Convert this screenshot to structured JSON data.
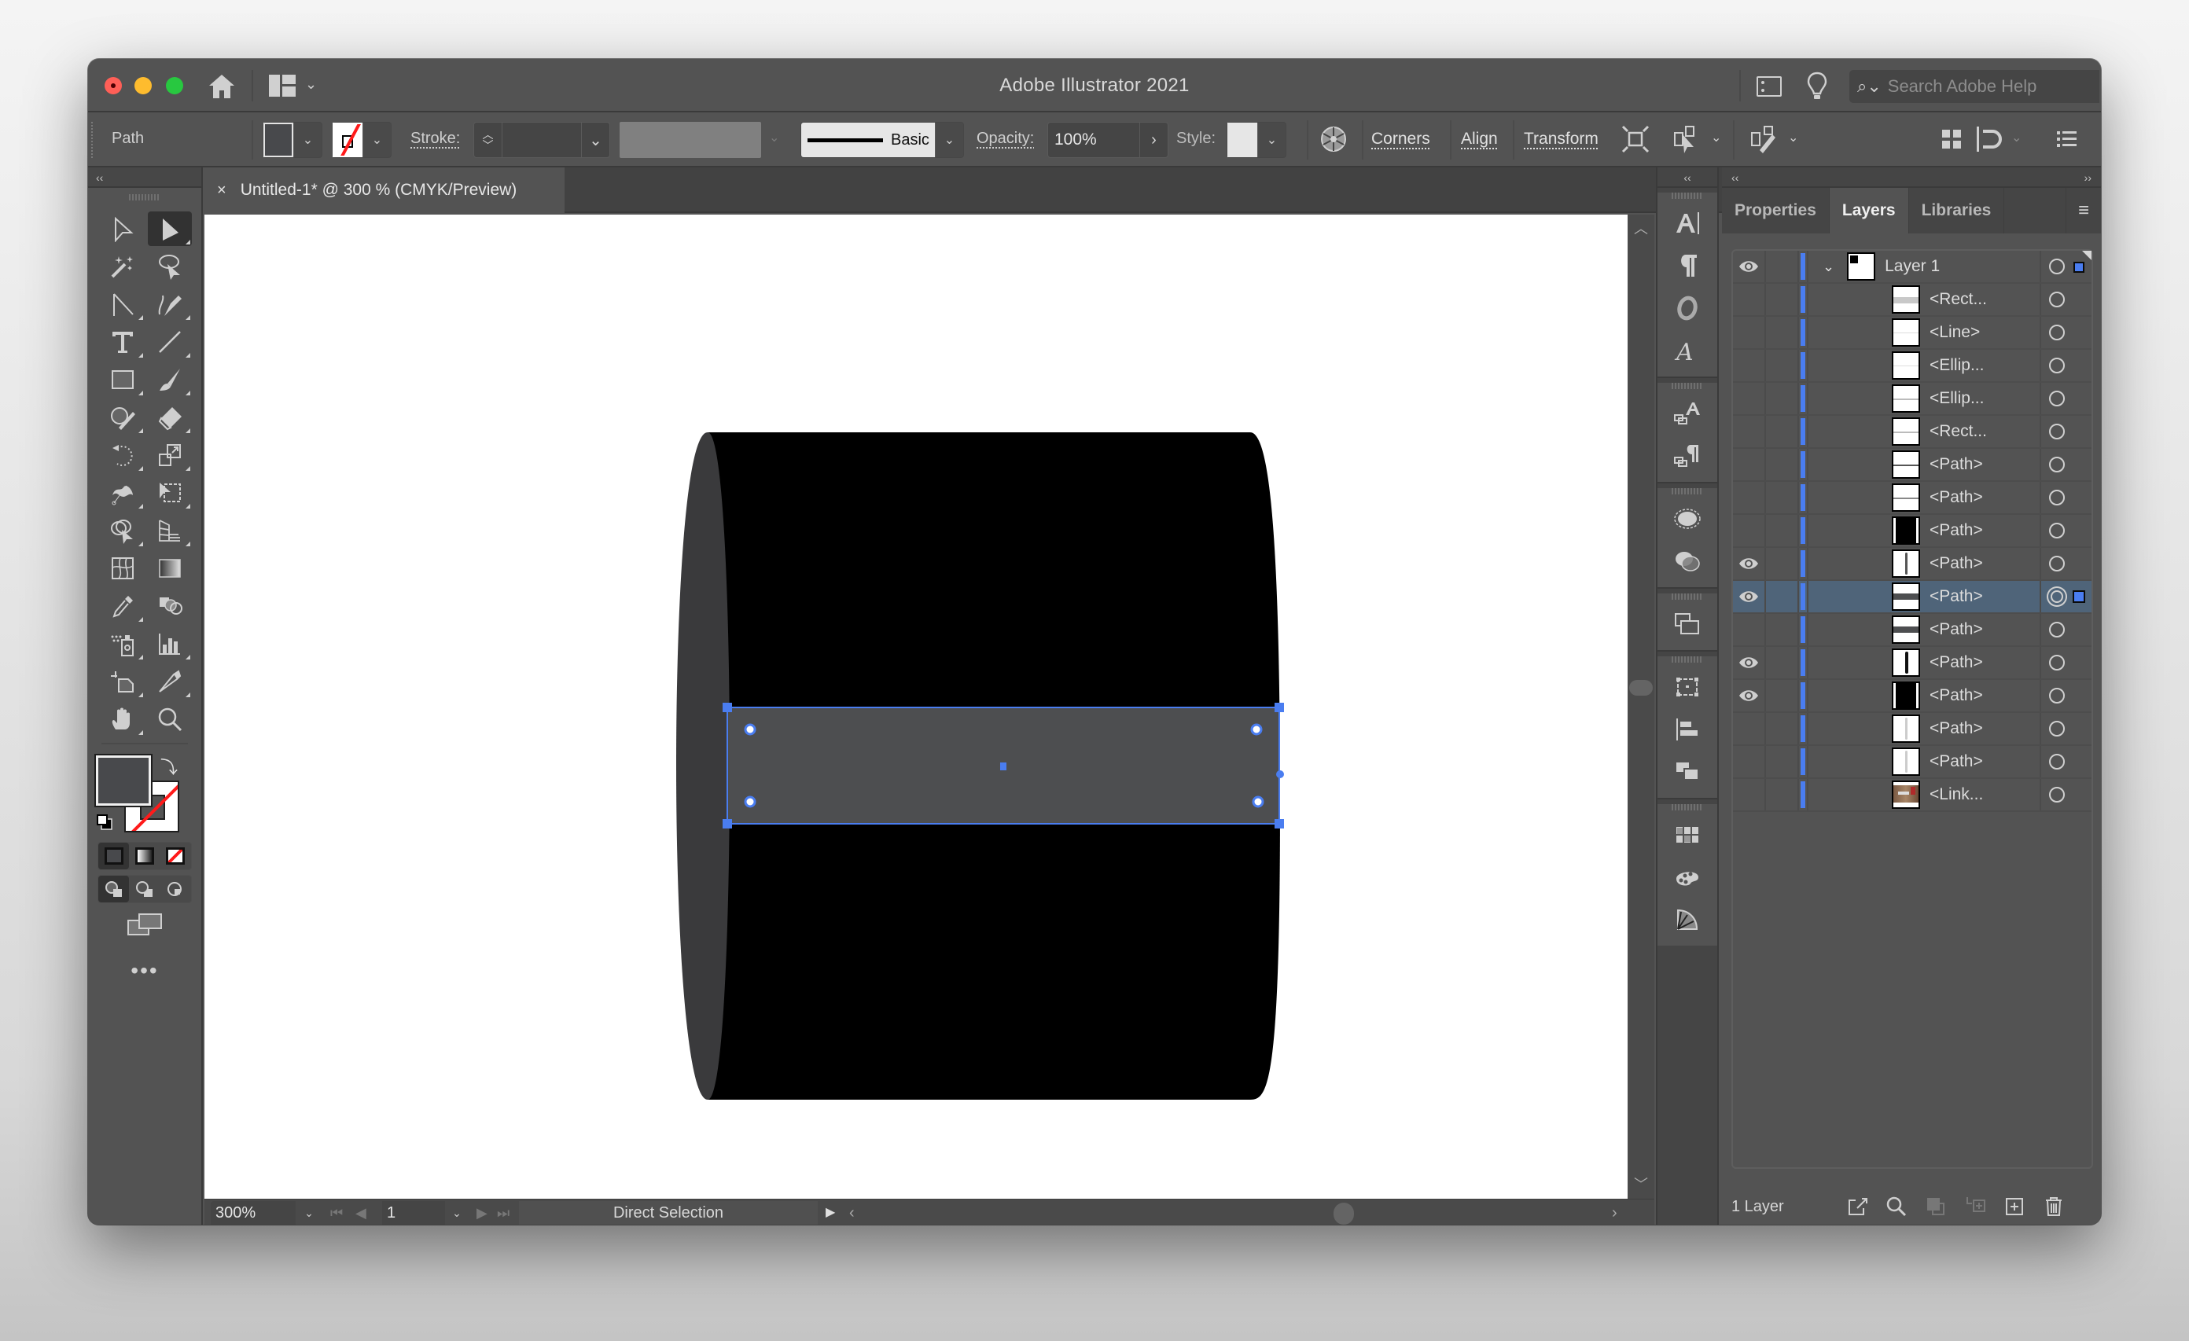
{
  "window": {
    "title": "Adobe Illustrator 2021",
    "help_search_placeholder": "Search Adobe Help"
  },
  "control_bar": {
    "selection_type": "Path",
    "fill_color": "#48494c",
    "stroke_color": "none",
    "stroke_label": "Stroke:",
    "stroke_weight": "",
    "brush_definition": "Basic",
    "opacity_label": "Opacity:",
    "opacity_value": "100%",
    "style_label": "Style:",
    "links": [
      "Corners",
      "Align",
      "Transform"
    ]
  },
  "document_tab": {
    "close": "×",
    "title": "Untitled-1* @ 300 % (CMYK/Preview)"
  },
  "toolbar": {
    "active_tool": "Direct Selection",
    "fill_color": "#48494c",
    "stroke_color": "none",
    "more_label": "•••"
  },
  "status_bar": {
    "zoom": "300%",
    "artboard": "1",
    "current_tool": "Direct Selection"
  },
  "artwork": {
    "body_color": "#000000",
    "end_cap_color": "#3a3a3c",
    "selected_rect_color": "#4d4e50",
    "selection_color": "#4a7df0"
  },
  "panel": {
    "tabs": [
      "Properties",
      "Layers",
      "Libraries"
    ],
    "active_tab": "Layers",
    "layer": {
      "name": "Layer 1",
      "visible": true,
      "expanded": true,
      "color": "#4a7df0"
    },
    "items": [
      {
        "name": "<Rect...",
        "visible": false,
        "selected": false,
        "thumb": "hband-light"
      },
      {
        "name": "<Line>",
        "visible": false,
        "selected": false,
        "thumb": "hline-faint"
      },
      {
        "name": "<Ellip...",
        "visible": false,
        "selected": false,
        "thumb": "hline-faint"
      },
      {
        "name": "<Ellip...",
        "visible": false,
        "selected": false,
        "thumb": "hline-gray"
      },
      {
        "name": "<Rect...",
        "visible": false,
        "selected": false,
        "thumb": "hline-gray"
      },
      {
        "name": "<Path>",
        "visible": false,
        "selected": false,
        "thumb": "hline-dark"
      },
      {
        "name": "<Path>",
        "visible": false,
        "selected": false,
        "thumb": "hline-mid"
      },
      {
        "name": "<Path>",
        "visible": false,
        "selected": false,
        "thumb": "black-block"
      },
      {
        "name": "<Path>",
        "visible": true,
        "selected": false,
        "thumb": "vline-dark"
      },
      {
        "name": "<Path>",
        "visible": true,
        "selected": true,
        "thumb": "hband-dark"
      },
      {
        "name": "<Path>",
        "visible": false,
        "selected": false,
        "thumb": "hband-dark"
      },
      {
        "name": "<Path>",
        "visible": true,
        "selected": false,
        "thumb": "vline-black"
      },
      {
        "name": "<Path>",
        "visible": true,
        "selected": false,
        "thumb": "black-block"
      },
      {
        "name": "<Path>",
        "visible": false,
        "selected": false,
        "thumb": "vline-light"
      },
      {
        "name": "<Path>",
        "visible": false,
        "selected": false,
        "thumb": "vline-light"
      },
      {
        "name": "<Link...",
        "visible": false,
        "selected": false,
        "thumb": "photo"
      }
    ],
    "footer_count": "1 Layer"
  }
}
